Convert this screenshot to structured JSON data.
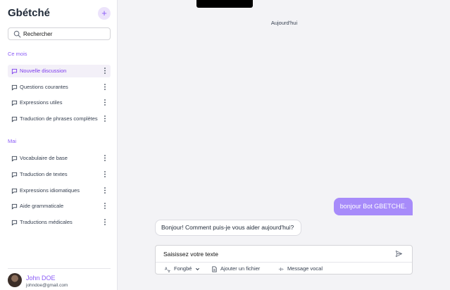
{
  "sidebar": {
    "brand": "Gbétché",
    "new_button": "+",
    "search": {
      "value": "Rechercher"
    },
    "groups": [
      {
        "label": "Ce mois",
        "items": [
          "Nouvelle discussion",
          "Questions courantes",
          "Expressions utiles",
          "Traduction de phrases complètes"
        ]
      },
      {
        "label": "Mai",
        "items": [
          "Vocabulaire de base",
          "Traduction de textes",
          "Expressions idiomatiques",
          "Aide grammaticale",
          "Traductions médicales"
        ]
      }
    ],
    "active_item": "Nouvelle discussion",
    "user": {
      "name": "John DOE",
      "email": "johndoe@gmail.com"
    }
  },
  "chat": {
    "date_separator": "Aujourd'hui",
    "messages": [
      {
        "role": "user",
        "text": "bonjour Bot GBETCHE."
      },
      {
        "role": "bot",
        "text": "Bonjour! Comment puis-je vous aider aujourd'hui?"
      }
    ],
    "composer": {
      "input": "Saisissez votre texte",
      "language": "Fongbé",
      "attach_label": "Ajouter un fichier",
      "voice_label": "Message vocal"
    }
  },
  "colors": {
    "accent": "#8b5cf6",
    "user_bubble": "#a78bfa",
    "background": "#f3f3f6"
  },
  "icons": [
    "plus-icon",
    "search-icon",
    "chat-bubble-icon",
    "more-vertical-icon",
    "send-icon",
    "translate-icon",
    "chevron-down-icon",
    "file-icon",
    "voice-wave-icon"
  ]
}
